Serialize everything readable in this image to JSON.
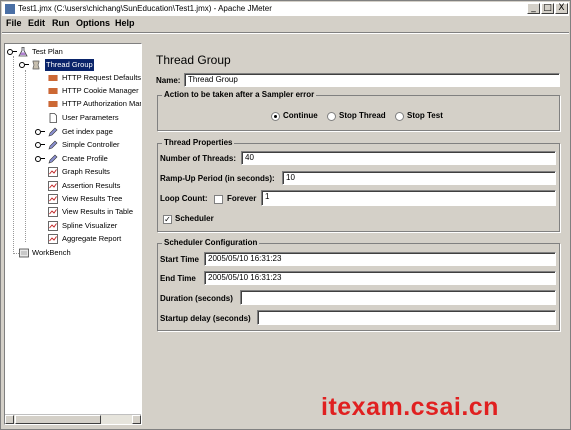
{
  "window": {
    "title": "Test1.jmx (C:\\users\\chichang\\SunEducation\\Test1.jmx) - Apache JMeter",
    "minimize": "_",
    "maximize": "□",
    "close": "X"
  },
  "menu": {
    "file": "File",
    "edit": "Edit",
    "run": "Run",
    "options": "Options",
    "help": "Help"
  },
  "tree": {
    "nodes": [
      {
        "label": "Test Plan",
        "icon": "flask-icon"
      },
      {
        "label": "Thread Group",
        "icon": "thread-group-icon",
        "selected": true
      },
      {
        "label": "HTTP Request Defaults",
        "icon": "config-element-icon"
      },
      {
        "label": "HTTP Cookie Manager",
        "icon": "config-element-icon"
      },
      {
        "label": "HTTP Authorization Mar",
        "icon": "config-element-icon"
      },
      {
        "label": "User Parameters",
        "icon": "document-icon"
      },
      {
        "label": "Get index page",
        "icon": "sampler-pencil-icon"
      },
      {
        "label": "Simple Controller",
        "icon": "controller-pencil-icon"
      },
      {
        "label": "Create Profile",
        "icon": "controller-pencil-icon"
      },
      {
        "label": "Graph Results",
        "icon": "listener-icon"
      },
      {
        "label": "Assertion Results",
        "icon": "listener-icon"
      },
      {
        "label": "View Results Tree",
        "icon": "listener-icon"
      },
      {
        "label": "View Results in Table",
        "icon": "listener-icon"
      },
      {
        "label": "Spline Visualizer",
        "icon": "listener-icon"
      },
      {
        "label": "Aggregate Report",
        "icon": "listener-icon"
      },
      {
        "label": "WorkBench",
        "icon": "workbench-icon"
      }
    ]
  },
  "panel": {
    "title": "Thread Group",
    "name_label": "Name:",
    "name_value": "Thread Group",
    "error_group_title": "Action to be taken after a Sampler error",
    "error_options": [
      {
        "label": "Continue",
        "selected": true
      },
      {
        "label": "Stop Thread",
        "selected": false
      },
      {
        "label": "Stop Test",
        "selected": false
      }
    ],
    "props_title": "Thread Properties",
    "threads_label": "Number of Threads:",
    "threads_value": "40",
    "rampup_label": "Ramp-Up Period (in seconds):",
    "rampup_value": "10",
    "loop_label": "Loop Count:",
    "forever_label": "Forever",
    "forever_checked": false,
    "loop_value": "1",
    "scheduler_label": "Scheduler",
    "scheduler_checked": true,
    "scheduler_mark": "✓",
    "sched_title": "Scheduler Configuration",
    "start_label": "Start Time",
    "start_value": "2005/05/10 16:31:23",
    "end_label": "End Time",
    "end_value": "2005/05/10 16:31:23",
    "duration_label": "Duration (seconds)",
    "duration_value": "",
    "delay_label": "Startup delay (seconds)",
    "delay_value": ""
  },
  "watermark": "itexam.csai.cn"
}
